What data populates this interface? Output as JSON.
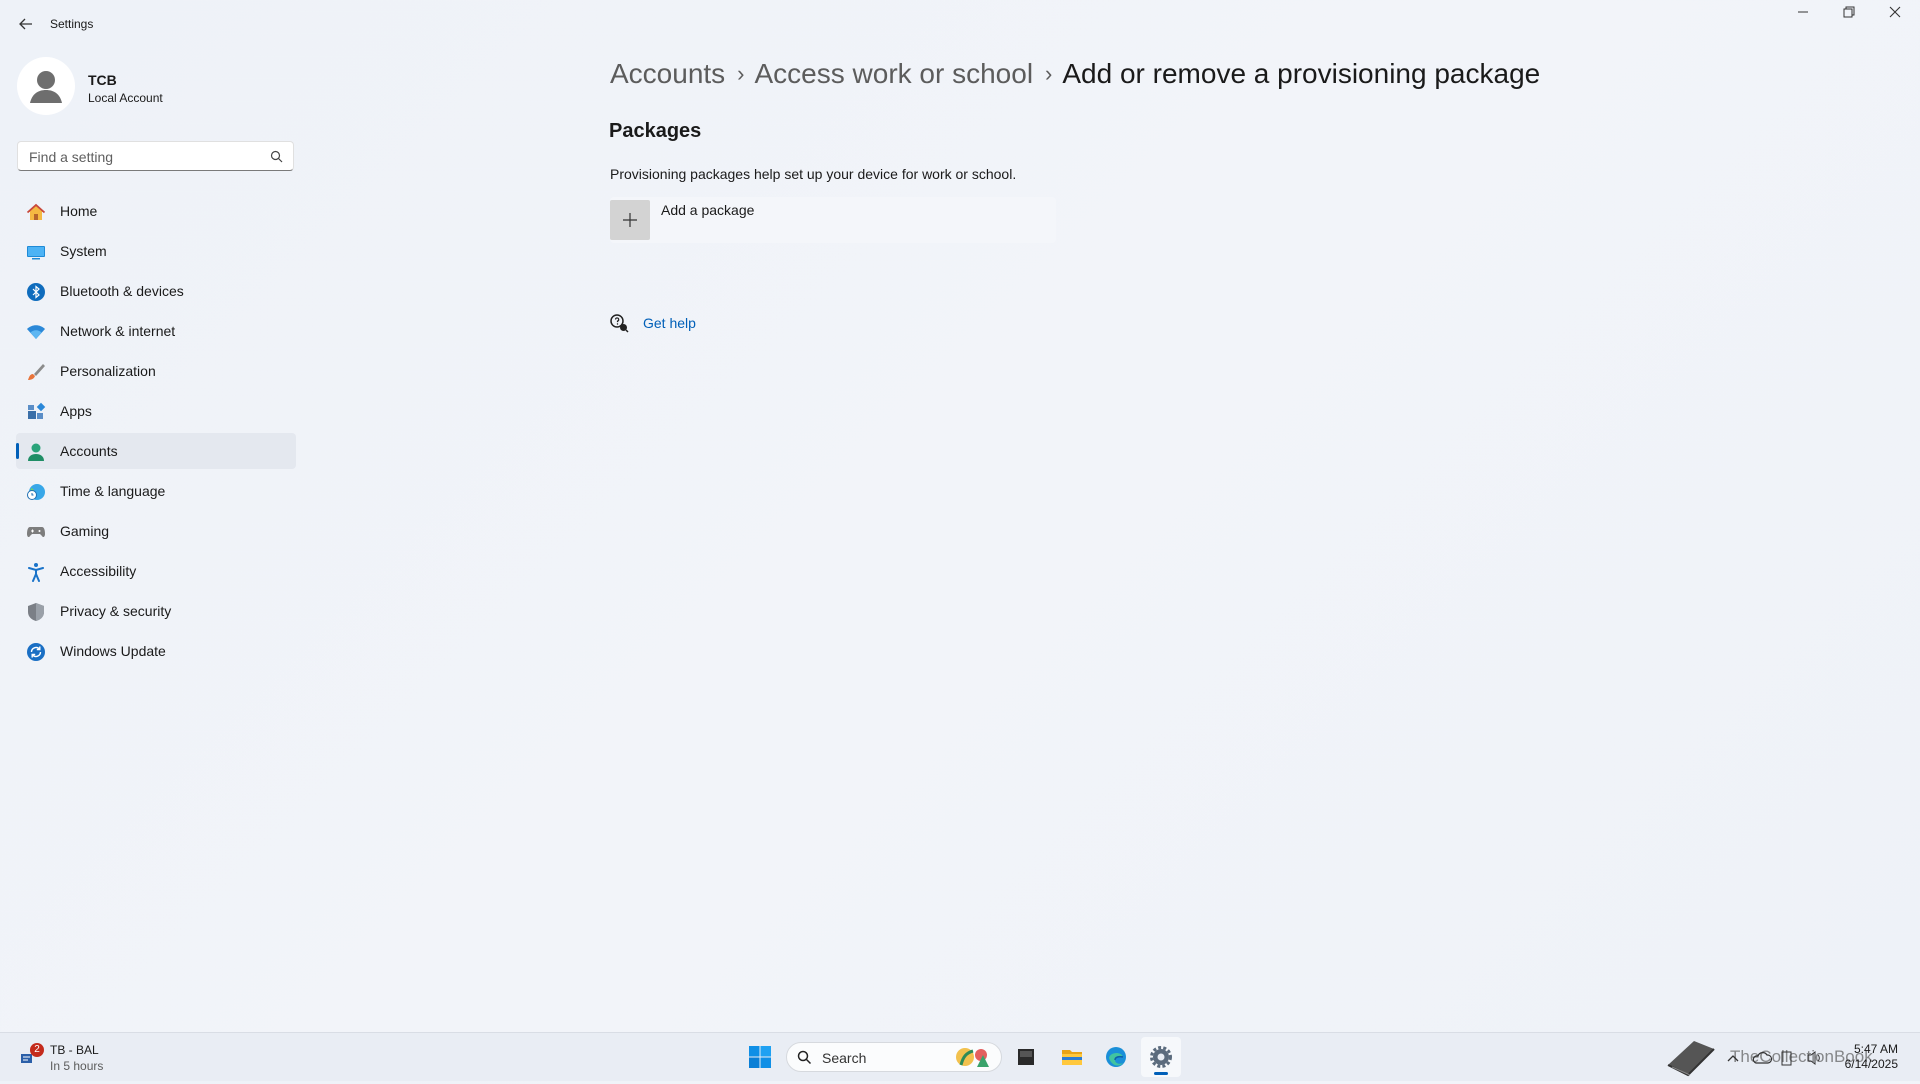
{
  "window": {
    "app_title": "Settings"
  },
  "profile": {
    "name": "TCB",
    "account_type": "Local Account"
  },
  "search": {
    "placeholder": "Find a setting"
  },
  "nav": {
    "items": [
      {
        "label": "Home",
        "icon": "home-icon"
      },
      {
        "label": "System",
        "icon": "system-icon"
      },
      {
        "label": "Bluetooth & devices",
        "icon": "bluetooth-icon"
      },
      {
        "label": "Network & internet",
        "icon": "wifi-icon"
      },
      {
        "label": "Personalization",
        "icon": "brush-icon"
      },
      {
        "label": "Apps",
        "icon": "apps-icon"
      },
      {
        "label": "Accounts",
        "icon": "person-icon",
        "active": true
      },
      {
        "label": "Time & language",
        "icon": "globe-clock-icon"
      },
      {
        "label": "Gaming",
        "icon": "gamepad-icon"
      },
      {
        "label": "Accessibility",
        "icon": "accessibility-icon"
      },
      {
        "label": "Privacy & security",
        "icon": "shield-icon"
      },
      {
        "label": "Windows Update",
        "icon": "update-icon"
      }
    ]
  },
  "breadcrumb": {
    "level1": "Accounts",
    "level2": "Access work or school",
    "current": "Add or remove a provisioning package"
  },
  "packages": {
    "title": "Packages",
    "description": "Provisioning packages help set up your device for work or school.",
    "add_label": "Add a package"
  },
  "help": {
    "label": "Get help"
  },
  "taskbar": {
    "weather_title": "TB - BAL",
    "weather_subtitle": "In 5 hours",
    "weather_badge": "2",
    "search_label": "Search",
    "watermark": "TheCollectionBook",
    "time": "5:47 AM",
    "date": "6/14/2025"
  },
  "colors": {
    "accent": "#005fb8",
    "badge": "#c42b1c"
  }
}
